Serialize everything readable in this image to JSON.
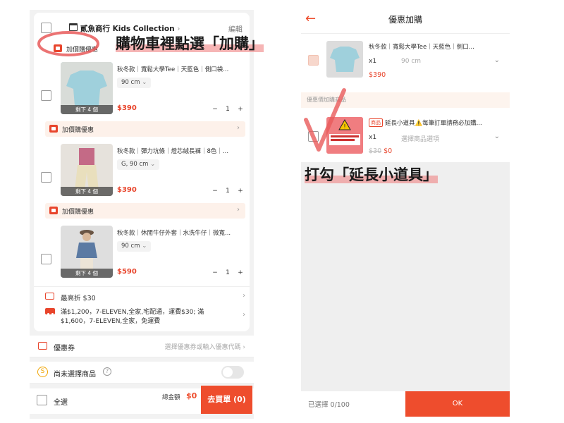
{
  "left_screen": {
    "shop": {
      "name": "貳魚商行 Kids Collection",
      "chevron": "›",
      "edit_label": "編輯"
    },
    "promo_label": "加價購優惠",
    "promo_chevron": "›",
    "items": [
      {
        "title": "秋冬款｜寬鬆大學Tee｜天藍色｜側口袋...",
        "variant": "90 cm",
        "price": "$390",
        "remaining": "剩下 4 個",
        "qty": "1",
        "minus": "−",
        "plus": "+",
        "thumb_color": "#a9d3dc"
      },
      {
        "title": "秋冬款｜彈力坑條｜燈芯絨長褲｜8色｜...",
        "variant": "G, 90 cm",
        "price": "$390",
        "remaining": "剩下 4 個",
        "qty": "1",
        "minus": "−",
        "plus": "+",
        "thumb_color": "#c9b58f"
      },
      {
        "title": "秋冬款｜休閒牛仔外套｜水洗牛仔｜微寬...",
        "variant": "90 cm",
        "price": "$590",
        "remaining": "剩下 4 個",
        "qty": "1",
        "minus": "−",
        "plus": "+",
        "thumb_color": "#6c7f99"
      }
    ],
    "discount": {
      "text": "最高折 $30",
      "chevron": "›"
    },
    "shipping": {
      "line1": "滿$1,200，7-ELEVEN,全家,宅配通，運費$30; 滿",
      "line2": "$1,600，7-ELEVEN,全家，免運費",
      "chevron": "›"
    },
    "coupon": {
      "label": "優惠券",
      "placeholder": "選擇優惠券或輸入優惠代碼",
      "chevron": "›"
    },
    "coins": {
      "label": "尚未選擇商品",
      "help": "?"
    },
    "footer": {
      "select_all": "全選",
      "total_label": "總金額",
      "total_value": "$0",
      "checkout": "去買單 (0)"
    }
  },
  "right_screen": {
    "title": "優惠加購",
    "back": "←",
    "main_item": {
      "title": "秋冬款｜寬鬆大學Tee｜天藍色｜側口...",
      "qty": "x1",
      "variant": "90 cm",
      "price": "$390",
      "chevron": "⌄"
    },
    "section_label": "優惠價加購商品",
    "addon_item": {
      "badge": "商品",
      "title": "延長小道具⚠️每筆訂單請務必加購...",
      "qty": "x1",
      "variant": "選擇商品選項",
      "original_price": "$30",
      "price": "$0",
      "chevron": "⌄",
      "thumb_text": "結帳時必加購此商品 訂單才會成立！"
    },
    "footer": {
      "count": "已選擇 0/100",
      "ok": "OK"
    }
  },
  "annotations": {
    "note1": "購物車裡點選「加購」",
    "note2": "打勾「延長小道具」",
    "colors": {
      "marker": "#e85a5a",
      "highlight": "#f08a8a"
    }
  },
  "colors": {
    "accent": "#ee4d2d",
    "price": "#e8452c"
  }
}
